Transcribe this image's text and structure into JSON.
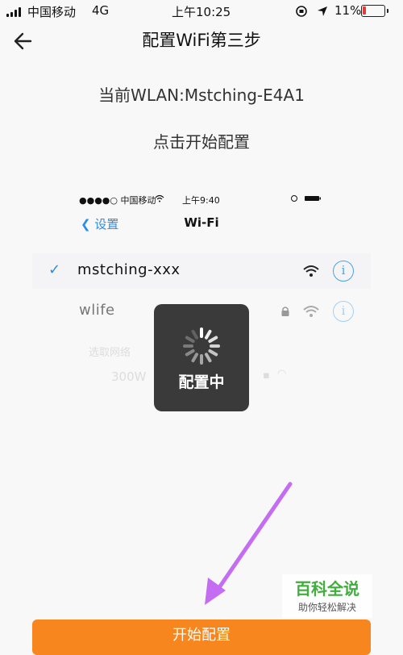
{
  "status_bar": {
    "carrier": "中国移动",
    "network": "4G",
    "time": "上午10:25",
    "battery": "11%",
    "battery_level": 0.11
  },
  "header": {
    "title": "配置WiFi第三步",
    "back_icon": "arrow-left-icon"
  },
  "current_wlan": "当前WLAN:Mstching-E4A1",
  "instruction": "点击开始配置",
  "illustration": {
    "status_carrier": "●●●●○ 中国移动",
    "status_time": "上午9:40",
    "nav_back": "设置",
    "nav_title": "Wi-Fi",
    "networks": [
      {
        "name": "mstching-xxx",
        "selected": true,
        "locked": false
      },
      {
        "name": "wlife",
        "selected": false,
        "locked": true
      }
    ],
    "section_label": "选取网络",
    "faded_network": "300W"
  },
  "loading": {
    "label": "配置中"
  },
  "watermark": {
    "title": "百科全说",
    "subtitle": "助你轻松解决"
  },
  "start_button": {
    "label": "开始配置"
  },
  "colors": {
    "accent": "#f7861f",
    "link": "#2b8de6",
    "arrow": "#c46cf2",
    "watermark_green": "#3fae3a"
  }
}
